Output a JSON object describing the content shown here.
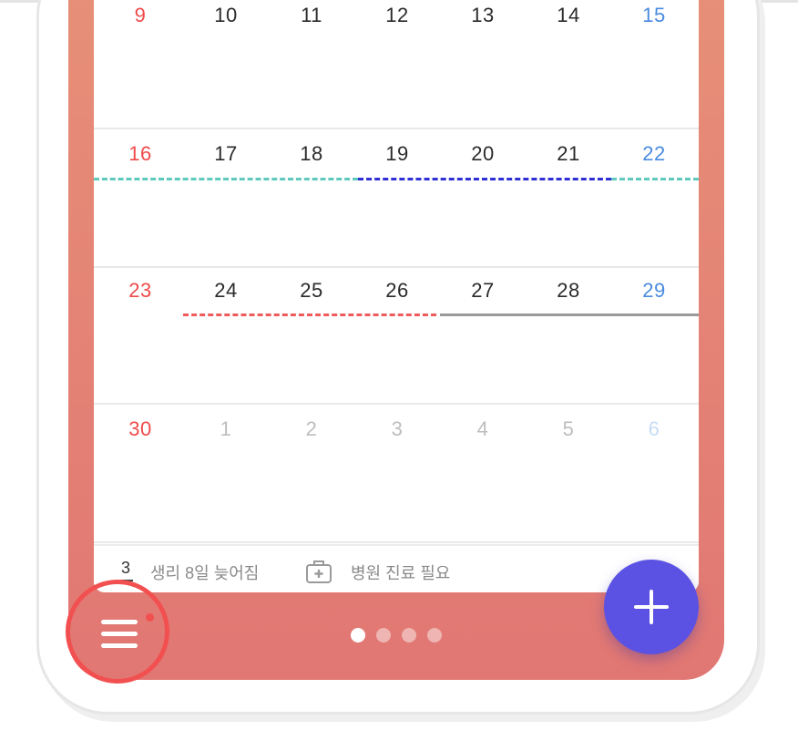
{
  "calendar": {
    "weeks": [
      {
        "days": [
          "9",
          "10",
          "11",
          "12",
          "13",
          "14",
          "15"
        ]
      },
      {
        "days": [
          "16",
          "17",
          "18",
          "19",
          "20",
          "21",
          "22"
        ]
      },
      {
        "days": [
          "23",
          "24",
          "25",
          "26",
          "27",
          "28",
          "29"
        ]
      },
      {
        "days": [
          "30",
          "1",
          "2",
          "3",
          "4",
          "5",
          "6"
        ]
      }
    ],
    "colors": {
      "sunday": "#ef4a4a",
      "saturday": "#4a8be0",
      "weekday": "#2b2b2b",
      "outside_month": "#bdbdbd",
      "event_teal": "#5fc9bd",
      "event_blue": "#2f2fd6",
      "event_red": "#ef5a5a",
      "event_gray": "#9a9a9a"
    }
  },
  "summary": {
    "count": "3",
    "period_text": "생리 8일 늦어짐",
    "hospital_text": "병원 진료 필요",
    "icon": "medical-kit-icon"
  },
  "pager": {
    "count": 4,
    "active_index": 0
  },
  "buttons": {
    "menu_icon": "hamburger-menu-icon",
    "add_icon": "plus-icon",
    "accent": "#5b52e3"
  }
}
